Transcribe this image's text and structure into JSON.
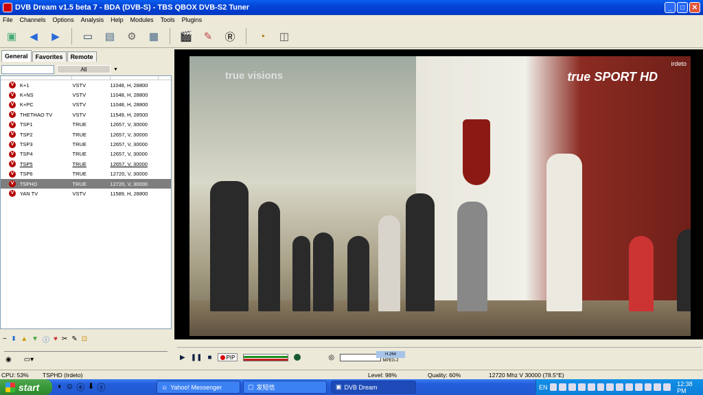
{
  "window": {
    "title": "DVB Dream v1.5 beta 7 - BDA (DVB-S)  -  TBS QBOX DVB-S2 Tuner"
  },
  "menu": [
    "File",
    "Channels",
    "Options",
    "Analysis",
    "Help",
    "Modules",
    "Tools",
    "Plugins"
  ],
  "tabs": [
    "General",
    "Favorites",
    "Remote"
  ],
  "filter": {
    "value": "",
    "dropdown": "All"
  },
  "channels": [
    {
      "name": "K+1",
      "provider": "VSTV",
      "tp": "11048, H, 28800"
    },
    {
      "name": "K+NS",
      "provider": "VSTV",
      "tp": "11048, H, 28800"
    },
    {
      "name": "K+PC",
      "provider": "VSTV",
      "tp": "11048, H, 28800"
    },
    {
      "name": "THETHAO TV",
      "provider": "VSTV",
      "tp": "11549, H, 28500"
    },
    {
      "name": "TSP1",
      "provider": "TRUE",
      "tp": "12657, V, 30000"
    },
    {
      "name": "TSP2",
      "provider": "TRUE",
      "tp": "12657, V, 30000"
    },
    {
      "name": "TSP3",
      "provider": "TRUE",
      "tp": "12657, V, 30000"
    },
    {
      "name": "TSP4",
      "provider": "TRUE",
      "tp": "12657, V, 30000"
    },
    {
      "name": "TSP5",
      "provider": "TRUE",
      "tp": "12657, V, 30000"
    },
    {
      "name": "TSP6",
      "provider": "TRUE",
      "tp": "12720, V, 30000"
    },
    {
      "name": "TSPHD",
      "provider": "TRUE",
      "tp": "12720, V, 30000"
    },
    {
      "name": "YAN TV",
      "provider": "VSTV",
      "tp": "11589, H, 28800"
    }
  ],
  "video": {
    "watermark_left": "true visions",
    "watermark_right": "true SPORT HD",
    "watermark_corner": "irdeto"
  },
  "controls": {
    "pip": "PIP",
    "codec": "H.264",
    "codec2": "MPEG-2"
  },
  "status": {
    "cpu": "CPU: 53%",
    "channel": "TSPHD (Irdeto)",
    "level": "Level: 98%",
    "quality": "Quality: 60%",
    "freq": "12720 Mhz  V  30000   (78.5°E)"
  },
  "taskbar": {
    "start": "start",
    "apps": [
      "Yahoo! Messenger",
      "发短信",
      "DVB Dream"
    ],
    "lang": "EN",
    "clock": "12:38 PM"
  }
}
